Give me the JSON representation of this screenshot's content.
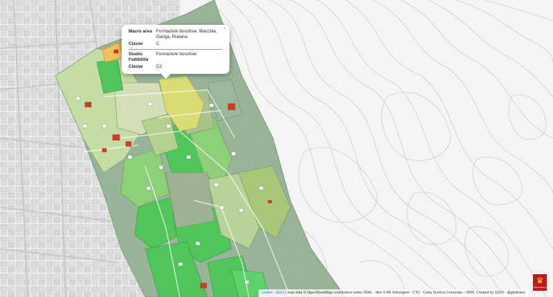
{
  "map": {
    "layers": [
      "base-map",
      "landuse-zones",
      "contour-lines",
      "buildings",
      "roads",
      "zone-labels"
    ],
    "colors": {
      "background": "#f4f4f4",
      "zone_light_green": "#c6dca5",
      "zone_mid_green": "#8fcf7a",
      "zone_bright_green": "#4fc55a",
      "zone_olive": "#97b07a",
      "zone_yellow": "#d9dc73",
      "zone_gray_green": "#8ca88c",
      "zone_orange": "#f1bf5b",
      "building_red": "#d33a2b"
    }
  },
  "popup": {
    "rows_section1": [
      {
        "key": "Macro area",
        "value": "Formazioni boschive, Macchia, Gariga, Prateria"
      },
      {
        "key": "Classe",
        "value": "C"
      }
    ],
    "rows_section2": [
      {
        "key": "Studio Fattibilità",
        "value": "Formazioni boschive"
      },
      {
        "key": "Classe",
        "value": "C2"
      }
    ],
    "close_label": "×"
  },
  "attribution": {
    "leaflet": "Leaflet",
    "qgis": "QGIS",
    "text": " | map data © OpenStreetMap contributors under ODbL - tiles © Alf. Ettrangère - CTC - Carta Tecnica Comunale – 2006, Created by QGIS - @gbvitrano"
  },
  "logo": {
    "text": "Città di Palermo",
    "icon": "crest-icon"
  }
}
